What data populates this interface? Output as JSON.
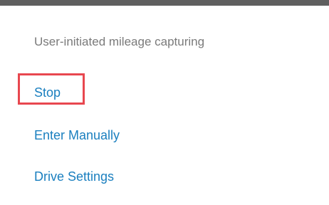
{
  "menu": {
    "header": "User-initiated mileage capturing",
    "items": [
      {
        "label": "Stop"
      },
      {
        "label": "Enter Manually"
      },
      {
        "label": "Drive Settings"
      }
    ]
  },
  "colors": {
    "header_text": "#7a7a7a",
    "item_text": "#1a7fbf",
    "highlight": "#e8474f",
    "top_bar": "#5f5f5f"
  }
}
